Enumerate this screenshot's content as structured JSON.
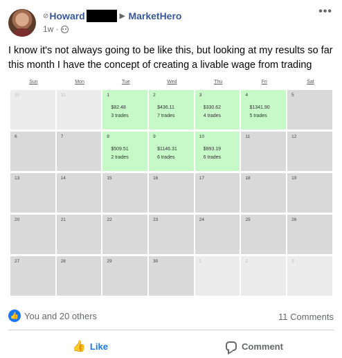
{
  "post": {
    "author": "Howard",
    "group": "MarketHero",
    "time": "1w ·",
    "body": "I know it's not always going to be like this, but looking at my results so far this month I have the concept of creating a livable wage from trading",
    "more_label": "•••"
  },
  "calendar": {
    "days_of_week": [
      "Sun",
      "Mon",
      "Tue",
      "Wed",
      "Thu",
      "Fri",
      "Sat"
    ],
    "weeks": [
      [
        {
          "n": "30",
          "s": "muted"
        },
        {
          "n": "31",
          "s": "muted"
        },
        {
          "n": "1",
          "s": "green",
          "amt": "$82.48",
          "trades": "3 trades"
        },
        {
          "n": "2",
          "s": "green",
          "amt": "$436.11",
          "trades": "7 trades"
        },
        {
          "n": "3",
          "s": "green",
          "amt": "$330.62",
          "trades": "4 trades"
        },
        {
          "n": "4",
          "s": "green",
          "amt": "$1341.90",
          "trades": "5 trades"
        },
        {
          "n": "5",
          "s": "gray"
        }
      ],
      [
        {
          "n": "6",
          "s": "gray"
        },
        {
          "n": "7",
          "s": "gray"
        },
        {
          "n": "8",
          "s": "green",
          "amt": "$509.51",
          "trades": "2 trades"
        },
        {
          "n": "9",
          "s": "green",
          "amt": "$1146.31",
          "trades": "6 trades"
        },
        {
          "n": "10",
          "s": "green",
          "amt": "$993.19",
          "trades": "6 trades"
        },
        {
          "n": "11",
          "s": "gray"
        },
        {
          "n": "12",
          "s": "gray"
        }
      ],
      [
        {
          "n": "13",
          "s": "gray"
        },
        {
          "n": "14",
          "s": "gray"
        },
        {
          "n": "15",
          "s": "gray"
        },
        {
          "n": "16",
          "s": "gray"
        },
        {
          "n": "17",
          "s": "gray"
        },
        {
          "n": "18",
          "s": "gray"
        },
        {
          "n": "19",
          "s": "gray"
        }
      ],
      [
        {
          "n": "20",
          "s": "gray"
        },
        {
          "n": "21",
          "s": "gray"
        },
        {
          "n": "22",
          "s": "gray"
        },
        {
          "n": "23",
          "s": "gray"
        },
        {
          "n": "24",
          "s": "gray"
        },
        {
          "n": "25",
          "s": "gray"
        },
        {
          "n": "26",
          "s": "gray"
        }
      ],
      [
        {
          "n": "27",
          "s": "gray"
        },
        {
          "n": "28",
          "s": "gray"
        },
        {
          "n": "29",
          "s": "gray"
        },
        {
          "n": "30",
          "s": "gray"
        },
        {
          "n": "1",
          "s": "muted"
        },
        {
          "n": "2",
          "s": "muted"
        },
        {
          "n": "3",
          "s": "muted"
        }
      ]
    ]
  },
  "footer": {
    "reactions_text": "You and 20 others",
    "comments_count": "11 Comments",
    "like_label": "Like",
    "comment_label": "Comment"
  },
  "colors": {
    "link_blue": "#385898",
    "fb_blue": "#1877f2",
    "profit_green": "#c6f8c8",
    "empty_day": "#d9d9d9"
  },
  "icons": [
    "privacy-icon",
    "arrow-right-icon",
    "globe-icon",
    "more-icon",
    "like-reaction-icon",
    "thumb-up-icon",
    "comment-icon"
  ]
}
